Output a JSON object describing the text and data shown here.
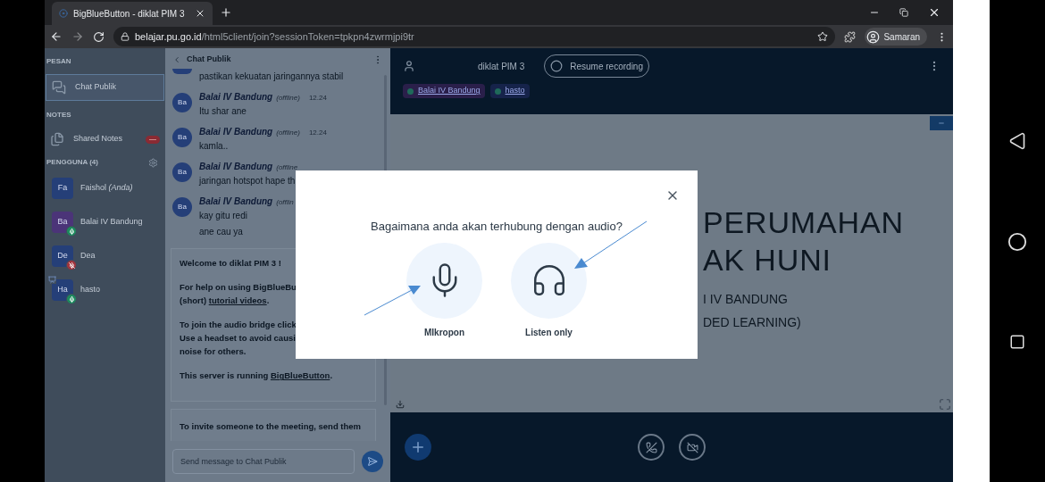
{
  "browser": {
    "tab_title": "BigBlueButton - diklat PIM 3",
    "url_host": "belajar.pu.go.id",
    "url_path": "/html5client/join?sessionToken=tpkpn4zwrmjpi9tr",
    "profile": "Samaran"
  },
  "sidebar": {
    "messages_heading": "PESAN",
    "public_chat": {
      "label": "Chat Publik",
      "selected": true
    },
    "notes_heading": "NOTES",
    "shared_notes": "Shared Notes",
    "users_heading": "PENGGUNA (4)",
    "users": [
      {
        "initials": "Fa",
        "name": "Faishol *(Anda)*",
        "color": "#253f78",
        "in_audio": false,
        "presenter": false
      },
      {
        "initials": "Ba",
        "name": "Balai IV Bandung",
        "color": "#4b3478",
        "in_audio": true,
        "muted": false,
        "presenter": false
      },
      {
        "initials": "De",
        "name": "Dea",
        "color": "#253f78",
        "in_audio": true,
        "muted": true,
        "presenter": false
      },
      {
        "initials": "Ha",
        "name": "hasto",
        "color": "#253f78",
        "in_audio": true,
        "muted": false,
        "presenter": true
      }
    ]
  },
  "chat": {
    "title": "Chat Publik",
    "messages": [
      {
        "kind": "continuation",
        "lines": [
          "pastikan kekuatan jaringannya stabil"
        ]
      },
      {
        "kind": "message",
        "initials": "Ba",
        "sender": "Balai IV Bandung",
        "status": "(offline)",
        "time": "12.24",
        "lines": [
          "Itu shar ane"
        ]
      },
      {
        "kind": "message",
        "initials": "Ba",
        "sender": "Balai IV Bandung",
        "status": "(offline)",
        "time": "12.24",
        "lines": [
          "kamla.."
        ]
      },
      {
        "kind": "message",
        "initials": "Ba",
        "sender": "Balai IV Bandung",
        "status": "(offline",
        "lines": [
          "jaringan hotspot hape th"
        ]
      },
      {
        "kind": "message",
        "initials": "Ba",
        "sender": "Balai IV Bandung",
        "status": "(offlin",
        "lines": [
          "kay gitu redi",
          "ane cau ya"
        ]
      }
    ],
    "welcome": {
      "title": "Welcome to diklat PIM 3 !",
      "paragraphs": [
        [
          [
            {
              "text": "For help on using BigBlueBu"
            }
          ],
          [
            {
              "text": "(short) "
            },
            {
              "text": "tutorial videos",
              "link": true
            },
            {
              "text": "."
            }
          ]
        ],
        [
          [
            {
              "text": "To join the audio bridge click"
            }
          ],
          [
            {
              "text": "Use a headset to avoid causi"
            }
          ],
          [
            {
              "text": "noise for others."
            }
          ]
        ],
        [
          [
            {
              "text": "This server is running "
            },
            {
              "text": "BigBlueButton",
              "link": true
            },
            {
              "text": "."
            }
          ]
        ]
      ]
    },
    "invite": "To invite someone to the meeting, send them",
    "input": {
      "placeholder": "Send message to Chat Publik"
    }
  },
  "main": {
    "title": "diklat PIM 3",
    "record_button": "Resume recording",
    "talkers": [
      {
        "name": "Balai IV Bandung",
        "color": "#2a1f4a"
      },
      {
        "name": "hasto",
        "color": "#16234a"
      }
    ],
    "slide": [
      {
        "kind": "title",
        "text": "PERUMAHAN"
      },
      {
        "kind": "title",
        "text": "AK HUNI"
      },
      {
        "kind": "subtitle",
        "text": "I IV BANDUNG"
      },
      {
        "kind": "subtitle",
        "text": "DED LEARNING)"
      }
    ]
  },
  "modal": {
    "question": "Bagaimana anda akan terhubung dengan audio?",
    "options": [
      {
        "kind": "microphone",
        "label": "MIkropon"
      },
      {
        "kind": "headphones",
        "label": "Listen only"
      }
    ]
  }
}
